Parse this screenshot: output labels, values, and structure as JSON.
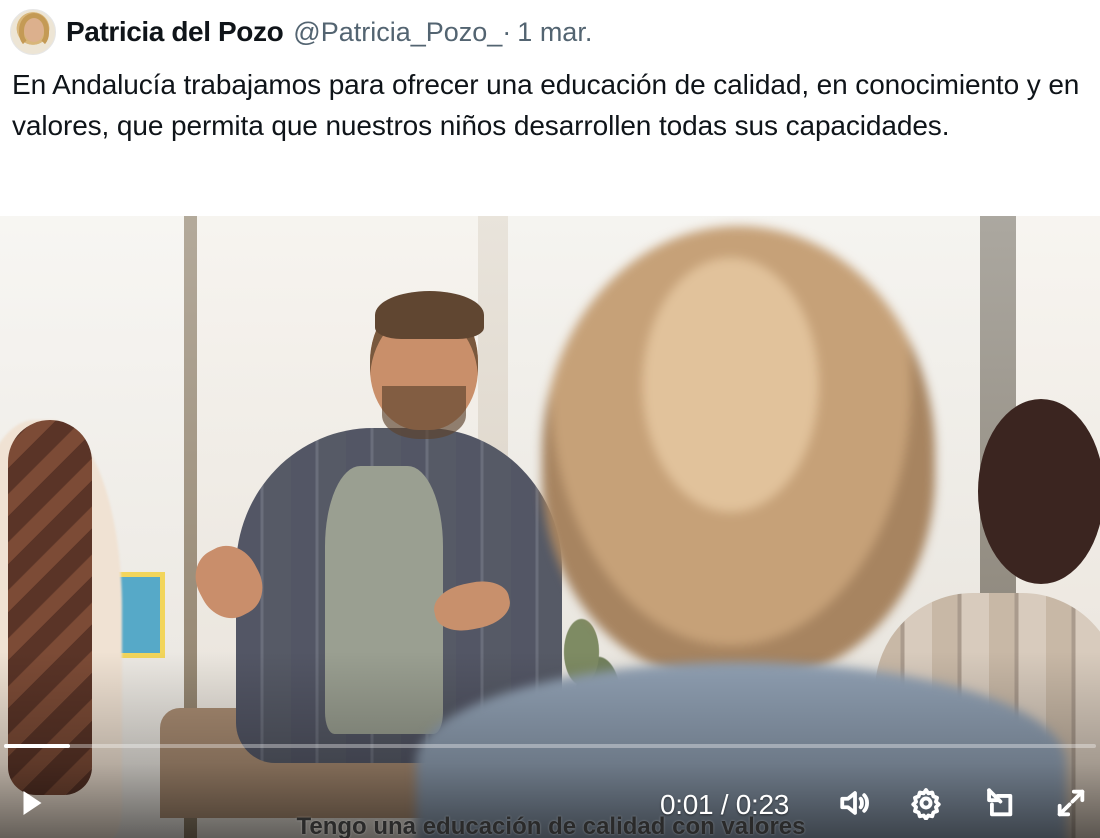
{
  "tweet": {
    "author_name": "Patricia del Pozo",
    "handle": "@Patricia_Pozo_",
    "separator": "·",
    "date": "1 mar.",
    "text": "En Andalucía trabajamos para ofrecer una educación de calidad, en conocimiento y en valores, que permita que nuestros niños desarrollen todas sus capacidades."
  },
  "video": {
    "current_time": "0:01",
    "duration": "0:23",
    "time_display": "0:01 / 0:23",
    "progress_fraction": 0.06,
    "subtitle": "Tengo una educación de calidad con valores",
    "icons": {
      "play": "play-icon",
      "volume": "volume-icon",
      "settings": "settings-gear-icon",
      "picture_in_picture": "picture-in-picture-icon",
      "fullscreen": "fullscreen-icon"
    }
  },
  "colors": {
    "text": "#0f1419",
    "muted": "#536471",
    "video_controls": "#ffffff"
  }
}
